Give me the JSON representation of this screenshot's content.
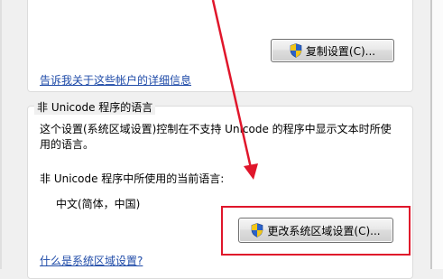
{
  "copy_settings_button": {
    "label": "复制设置(C)...",
    "icon": "uac-shield-icon"
  },
  "account_details_link": "告诉我关于这些帐户的详细信息",
  "non_unicode_section": {
    "legend": "非 Unicode 程序的语言",
    "description_line1": "这个设置(系统区域设置)控制在不支持 Unicode 的程序中显示文本时所使",
    "description_line2": "用的语言。",
    "current_language_label": "非 Unicode 程序中所使用的当前语言:",
    "current_language_value": "中文(简体，中国)",
    "change_locale_button": {
      "label": "更改系统区域设置(C)...",
      "icon": "uac-shield-icon"
    },
    "help_link": "什么是系统区域设置?"
  },
  "annotation": {
    "arrow_color": "#e0162b",
    "box_color": "#e0162b"
  }
}
